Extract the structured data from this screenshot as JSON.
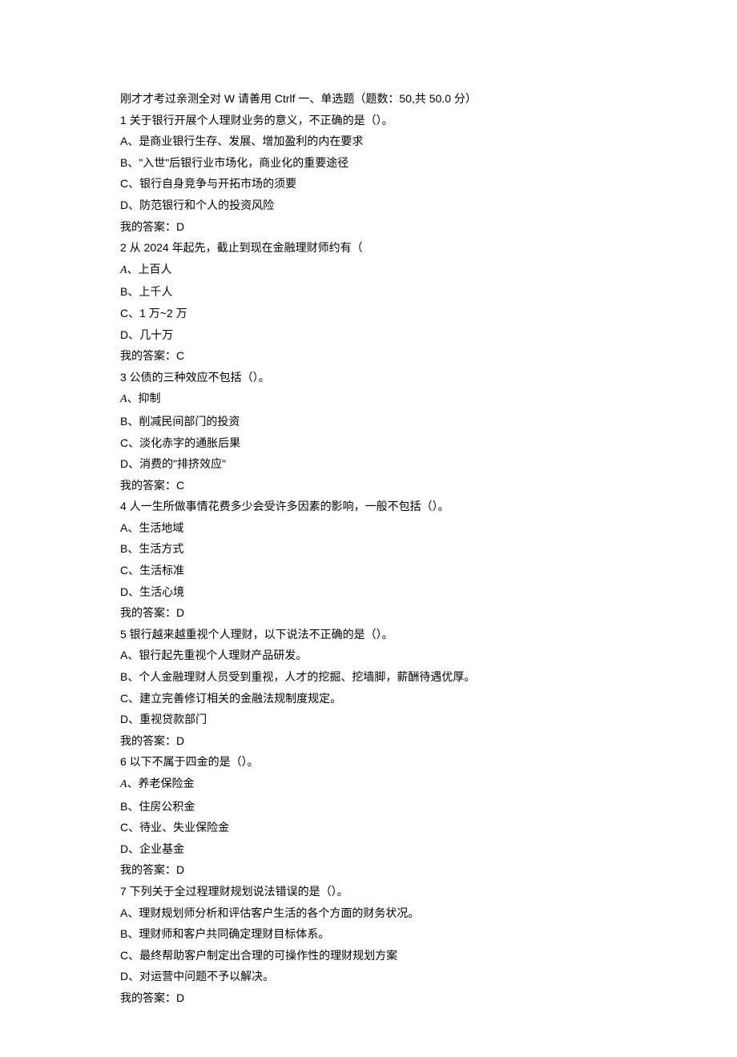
{
  "header": "刚才才考过亲测全对 W 请善用 Ctrlf 一、单选题（题数：50,共 50.0 分）",
  "questions": [
    {
      "stem": "1 关于银行开展个人理财业务的意义，不正确的是（）。",
      "options": [
        "A、是商业银行生存、发展、增加盈利的内在要求",
        "B、\"入世\"后银行业市场化，商业化的重要途径",
        "C、银行自身竞争与开拓市场的须要",
        "D、防范银行和个人的投资风险"
      ],
      "answer": "我的答案：D"
    },
    {
      "stem": "2 从 2024 年起先，截止到现在金融理财师约有（",
      "options": [
        "A、上百人",
        "B、上千人",
        "C、1 万~2 万",
        "D、几十万"
      ],
      "answer": "我的答案：C",
      "italicA": true
    },
    {
      "stem": "3 公债的三种效应不包括（）。",
      "options": [
        "A、抑制",
        "B、削减民间部门的投资",
        "C、淡化赤字的通胀后果",
        "D、消费的\"排挤效应\""
      ],
      "answer": "我的答案：C",
      "italicA": true
    },
    {
      "stem": "4 人一生所做事情花费多少会受许多因素的影响，一般不包括（）。",
      "options": [
        "A、生活地域",
        "B、生活方式",
        "C、生活标准",
        "D、生活心境"
      ],
      "answer": "我的答案：D"
    },
    {
      "stem": "5 银行越来越重视个人理财，以下说法不正确的是（）。",
      "options": [
        "A、银行起先重视个人理财产品研发。",
        "B、个人金融理财人员受到重视，人才的挖掘、挖墙脚，薪酬待遇优厚。",
        "C、建立完善修订相关的金融法规制度规定。",
        "D、重视贷款部门"
      ],
      "answer": "我的答案：D"
    },
    {
      "stem": "6 以下不属于四金的是（）。",
      "options": [
        "A、养老保险金",
        "B、住房公积金",
        "C、待业、失业保险金",
        "D、企业基金"
      ],
      "answer": "我的答案：D",
      "italicA": true
    },
    {
      "stem": "7 下列关于全过程理财规划说法错误的是（）。",
      "options": [
        "A、理财规划师分析和评估客户生活的各个方面的财务状况。",
        "B、理财师和客户共同确定理财目标体系。",
        "C、最终帮助客户制定出合理的可操作性的理财规划方案",
        "D、对运营中问题不予以解决。"
      ],
      "answer": "我的答案：D"
    }
  ]
}
